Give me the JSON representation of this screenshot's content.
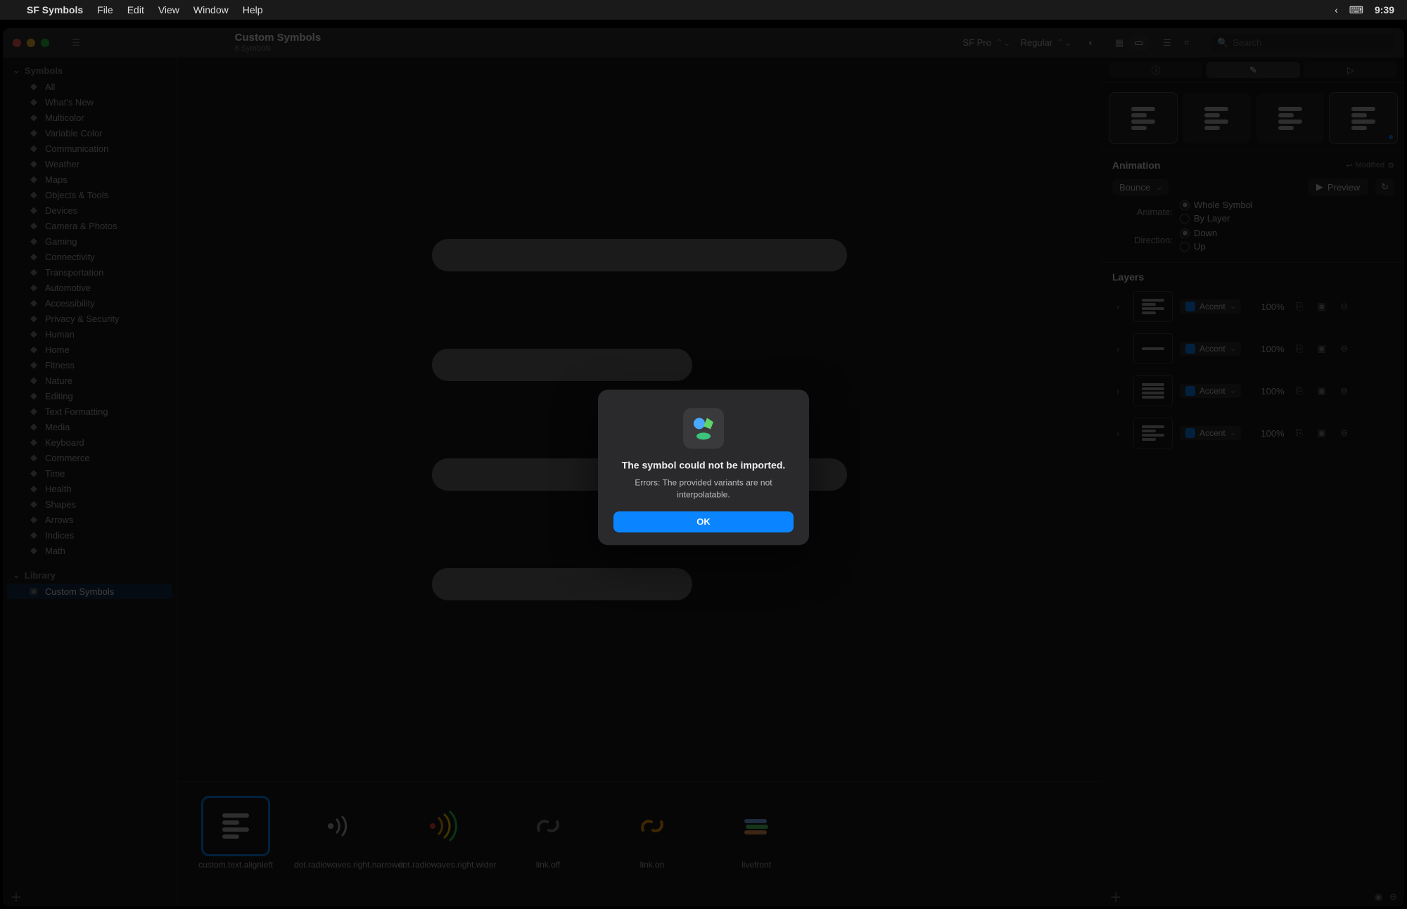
{
  "menubar": {
    "app": "SF Symbols",
    "items": [
      "File",
      "Edit",
      "View",
      "Window",
      "Help"
    ],
    "clock": "9:39"
  },
  "window": {
    "title": "Custom Symbols",
    "subtitle": "8 Symbols",
    "font_family": "SF Pro",
    "font_weight": "Regular",
    "search_placeholder": "Search"
  },
  "sidebar": {
    "symbols_header": "Symbols",
    "categories": [
      "All",
      "What's New",
      "Multicolor",
      "Variable Color",
      "Communication",
      "Weather",
      "Maps",
      "Objects & Tools",
      "Devices",
      "Camera & Photos",
      "Gaming",
      "Connectivity",
      "Transportation",
      "Automotive",
      "Accessibility",
      "Privacy & Security",
      "Human",
      "Home",
      "Fitness",
      "Nature",
      "Editing",
      "Text Formatting",
      "Media",
      "Keyboard",
      "Commerce",
      "Time",
      "Health",
      "Shapes",
      "Arrows",
      "Indices",
      "Math"
    ],
    "library_header": "Library",
    "library_items": [
      "Custom Symbols"
    ],
    "library_selected": "Custom Symbols"
  },
  "thumbnails": [
    {
      "name": "custom.text.alignleft",
      "selected": true
    },
    {
      "name": "dot.radiowaves.right.narrower",
      "selected": false
    },
    {
      "name": "dot.radiowaves.right.wider",
      "selected": false
    },
    {
      "name": "link.off",
      "selected": false
    },
    {
      "name": "link.on",
      "selected": false
    },
    {
      "name": "livefront",
      "selected": false
    }
  ],
  "inspector": {
    "animation_header": "Animation",
    "modified_label": "Modified",
    "animation_type": "Bounce",
    "preview_label": "Preview",
    "animate_label": "Animate:",
    "animate_options": [
      "Whole Symbol",
      "By Layer"
    ],
    "animate_selected": "Whole Symbol",
    "direction_label": "Direction:",
    "direction_options": [
      "Down",
      "Up"
    ],
    "direction_selected": "Down",
    "layers_header": "Layers",
    "render_mode": "Accent",
    "layers": [
      {
        "opacity": "100%"
      },
      {
        "opacity": "100%"
      },
      {
        "opacity": "100%"
      },
      {
        "opacity": "100%"
      }
    ]
  },
  "dialog": {
    "title": "The symbol could not be imported.",
    "message": "Errors: The provided variants are not interpolatable.",
    "ok": "OK"
  }
}
